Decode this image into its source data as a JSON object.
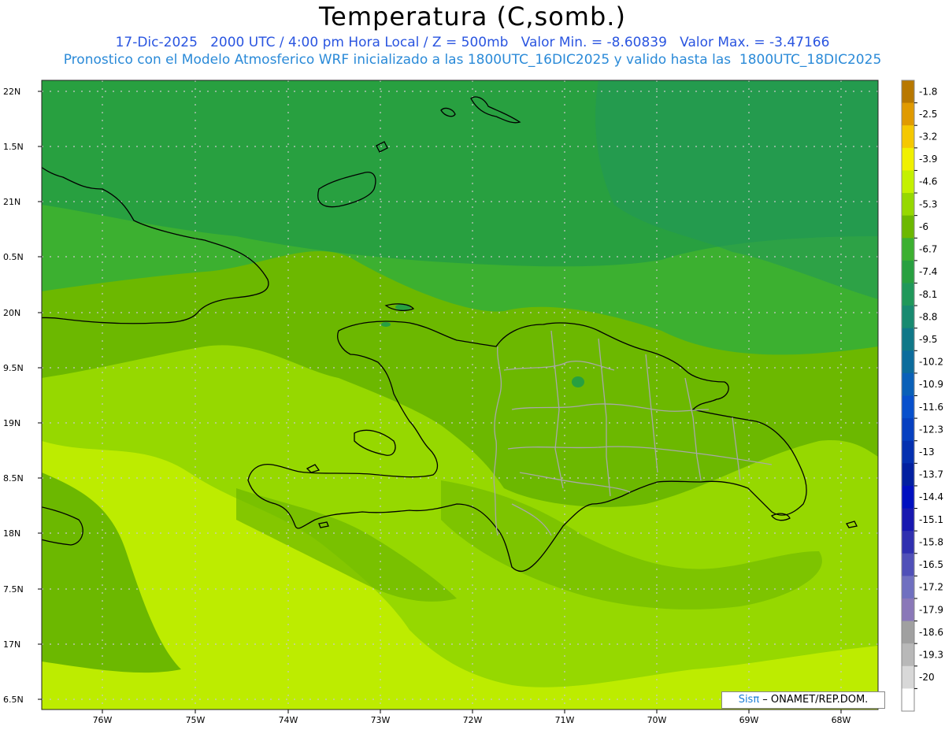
{
  "header": {
    "title": "Temperatura (C,somb.)",
    "line1": "17-Dic-2025   2000 UTC / 4:00 pm Hora Local / Z = 500mb   Valor Min. = -8.60839   Valor Max. = -3.47166",
    "line2": "Pronostico con el Modelo Atmosferico WRF inicializado a las 1800UTC_16DIC2025 y valido hasta las  1800UTC_18DIC2025"
  },
  "axes": {
    "lat_labels": [
      "22N",
      "1.5N",
      "21N",
      "0.5N",
      "20N",
      "9.5N",
      "19N",
      "8.5N",
      "18N",
      "7.5N",
      "17N",
      "6.5N"
    ],
    "lon_labels": [
      "76W",
      "75W",
      "74W",
      "73W",
      "72W",
      "71W",
      "70W",
      "69W",
      "68W"
    ]
  },
  "colorbar": {
    "labels": [
      "-1.8",
      "-2.5",
      "-3.2",
      "-3.9",
      "-4.6",
      "-5.3",
      "-6",
      "-6.7",
      "-7.4",
      "-8.1",
      "-8.8",
      "-9.5",
      "-10.2",
      "-10.9",
      "-11.6",
      "-12.3",
      "-13",
      "-13.7",
      "-14.4",
      "-15.1",
      "-15.8",
      "-16.5",
      "-17.2",
      "-17.9",
      "-18.6",
      "-19.3",
      "-20"
    ],
    "colors": [
      "#b87800",
      "#e09a00",
      "#f5c800",
      "#f0f000",
      "#c4f000",
      "#96d800",
      "#6cb800",
      "#3cb030",
      "#28a040",
      "#20985a",
      "#188a70",
      "#107888",
      "#0c6c9c",
      "#0a60b8",
      "#0850cc",
      "#0640c0",
      "#0430b0",
      "#0220a0",
      "#0010c0",
      "#1818b0",
      "#3030b0",
      "#5050b8",
      "#7070c0",
      "#8a78b8",
      "#a0a0a0",
      "#b8b8b8",
      "#d8d8d8",
      "#ffffff"
    ]
  },
  "credit": {
    "brand": "Sisπ",
    "text": " – ONAMET/REP.DOM."
  }
}
